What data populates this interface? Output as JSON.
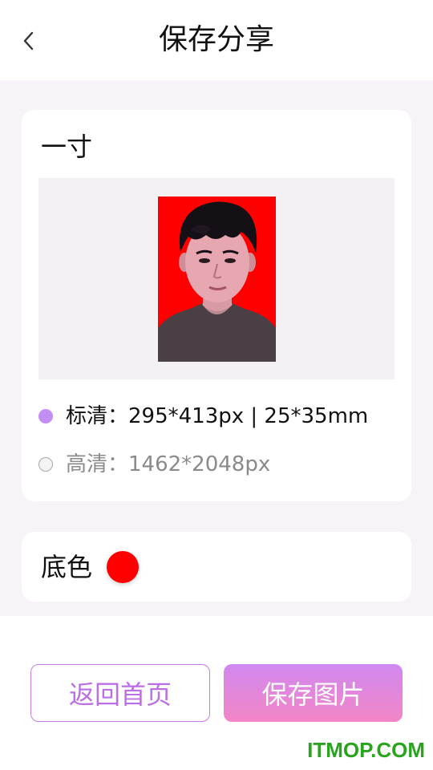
{
  "header": {
    "title": "保存分享",
    "back_icon": "chevron-left-icon"
  },
  "size_card": {
    "title": "一寸",
    "options": [
      {
        "label": "标清：295*413px | 25*35mm",
        "selected": true
      },
      {
        "label": "高清：1462*2048px",
        "selected": false
      }
    ]
  },
  "color_card": {
    "label": "底色",
    "color": "#ff0000"
  },
  "actions": {
    "home_label": "返回首页",
    "save_label": "保存图片"
  },
  "watermark": "ITMOP.COM"
}
